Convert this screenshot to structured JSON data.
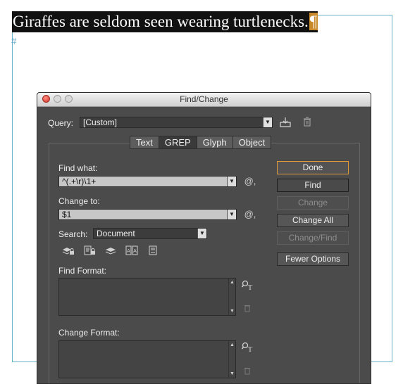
{
  "document": {
    "headline": "Giraffes are seldom seen wearing turtlenecks.",
    "pilcrow": "¶",
    "hash_mark": "#"
  },
  "dialog": {
    "title": "Find/Change",
    "query_label": "Query:",
    "query_value": "[Custom]",
    "tabs": [
      "Text",
      "GREP",
      "Glyph",
      "Object"
    ],
    "active_tab": "GREP",
    "find_what_label": "Find what:",
    "find_what_value": "^(.+\\r)\\1+",
    "change_to_label": "Change to:",
    "change_to_value": "$1",
    "special_char_symbol": "@,",
    "search_label": "Search:",
    "search_value": "Document",
    "find_format_label": "Find Format:",
    "change_format_label": "Change Format:",
    "buttons": {
      "done": "Done",
      "find": "Find",
      "change": "Change",
      "change_all": "Change All",
      "change_find": "Change/Find",
      "fewer_options": "Fewer Options"
    },
    "icons": {
      "save_query": "save-query-icon",
      "delete_query": "trash-icon",
      "search_options": [
        "include-locked-layers-icon",
        "include-locked-stories-icon",
        "include-hidden-layers-icon",
        "include-master-pages-icon",
        "include-footnotes-icon"
      ],
      "format_settings": "format-settings-icon",
      "clear_format": "trash-icon"
    },
    "colors": {
      "dialog_bg": "#4b4b4b",
      "default_button_border": "#e09a3a",
      "frame_guide": "#66b3c9"
    }
  }
}
